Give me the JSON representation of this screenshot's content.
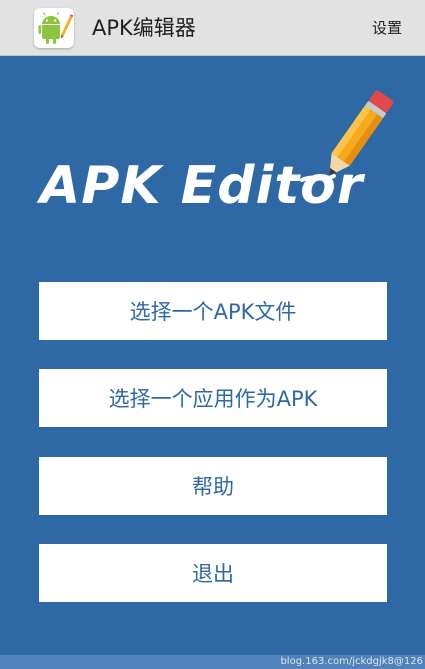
{
  "app_bar": {
    "title": "APK编辑器",
    "settings_label": "设置",
    "icon": "android-pencil-icon"
  },
  "logo": {
    "text": "APK Editor",
    "icon": "pencil-icon"
  },
  "menu": [
    {
      "label": "选择一个APK文件"
    },
    {
      "label": "选择一个应用作为APK"
    },
    {
      "label": "帮助"
    },
    {
      "label": "退出"
    }
  ],
  "footer": {
    "watermark": "blog.163.com/jckdgjk8@126"
  },
  "colors": {
    "background": "#2e69a6",
    "button_text": "#2e69a6",
    "app_bar": "#e2e2e2"
  }
}
